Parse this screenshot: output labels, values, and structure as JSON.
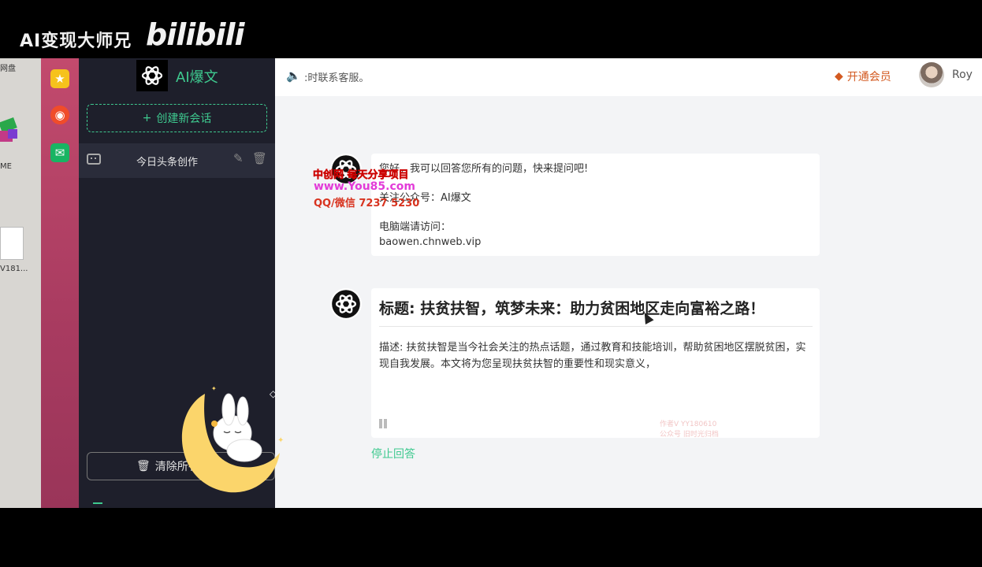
{
  "watermark": {
    "channel": "AI变现大师兄",
    "site_logo": "bilibili"
  },
  "desktop": {
    "label_top": "网盘",
    "label_mid": "ME",
    "label_file": "V181..."
  },
  "rail": {
    "icons": [
      "star-icon",
      "weibo-icon",
      "mail-icon"
    ]
  },
  "sidebar": {
    "app_name": "AI爆文",
    "new_chat_label": "创建新会话",
    "conversations": [
      {
        "label": "今日头条创作"
      }
    ],
    "clear_label": "清除所有"
  },
  "header": {
    "notice": ":时联系客服。",
    "vip_label": "开通会员",
    "username": "Roy"
  },
  "messages": [
    {
      "role": "assistant",
      "lines": [
        "您好，我可以回答您所有的问题，快来提问吧!",
        "关注公众号：AI爆文",
        "",
        "电脑端请访问：",
        "baowen.chnweb.vip"
      ]
    },
    {
      "role": "assistant",
      "title": "标题: 扶贫扶智，筑梦未来：助力贫困地区走向富裕之路！",
      "description": "描述: 扶贫扶智是当今社会关注的热点话题，通过教育和技能培训，帮助贫困地区摆脱贫困，实现自我发展。本文将为您呈现扶贫扶智的重要性和现实意义，"
    }
  ],
  "stop_label": "停止回答",
  "overlay": {
    "line1": "中创网 每天分享项目",
    "line2": "www.You85.com",
    "line3": "QQ/微信 7237 5230",
    "faint1": "作者V  YY180610",
    "faint2": "公众号  旧时光归档"
  },
  "colors": {
    "accent": "#3ec98f",
    "sidebar_bg": "#1e1f2b",
    "rail": "#b4416a",
    "vip": "#d35a21"
  }
}
